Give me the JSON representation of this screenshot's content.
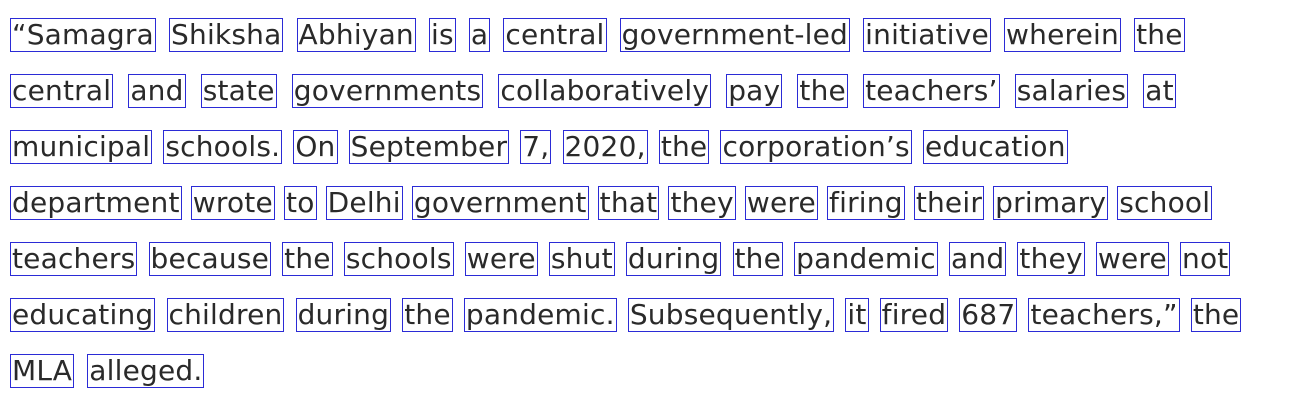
{
  "paragraph": {
    "lines": [
      [
        "“Samagra",
        "Shiksha",
        "Abhiyan",
        "is",
        "a",
        "central",
        "government-led",
        "initiative",
        "wherein",
        "the"
      ],
      [
        "central",
        "and",
        "state",
        "governments",
        "collaboratively",
        "pay",
        "the",
        "teachers’",
        "salaries",
        "at"
      ],
      [
        "municipal",
        "schools.",
        "On",
        "September",
        "7,",
        "2020,",
        "the",
        "corporation’s",
        "education"
      ],
      [
        "department",
        "wrote",
        "to",
        "Delhi",
        "government",
        "that",
        "they",
        "were",
        "firing",
        "their",
        "primary",
        "school"
      ],
      [
        "teachers",
        "because",
        "the",
        "schools",
        "were",
        "shut",
        "during",
        "the",
        "pandemic",
        "and",
        "they",
        "were",
        "not"
      ],
      [
        "educating",
        "children",
        "during",
        "the",
        "pandemic.",
        "Subsequently,",
        "it",
        "fired",
        "687",
        "teachers,”",
        "the"
      ],
      [
        "MLA",
        "alleged."
      ]
    ]
  }
}
